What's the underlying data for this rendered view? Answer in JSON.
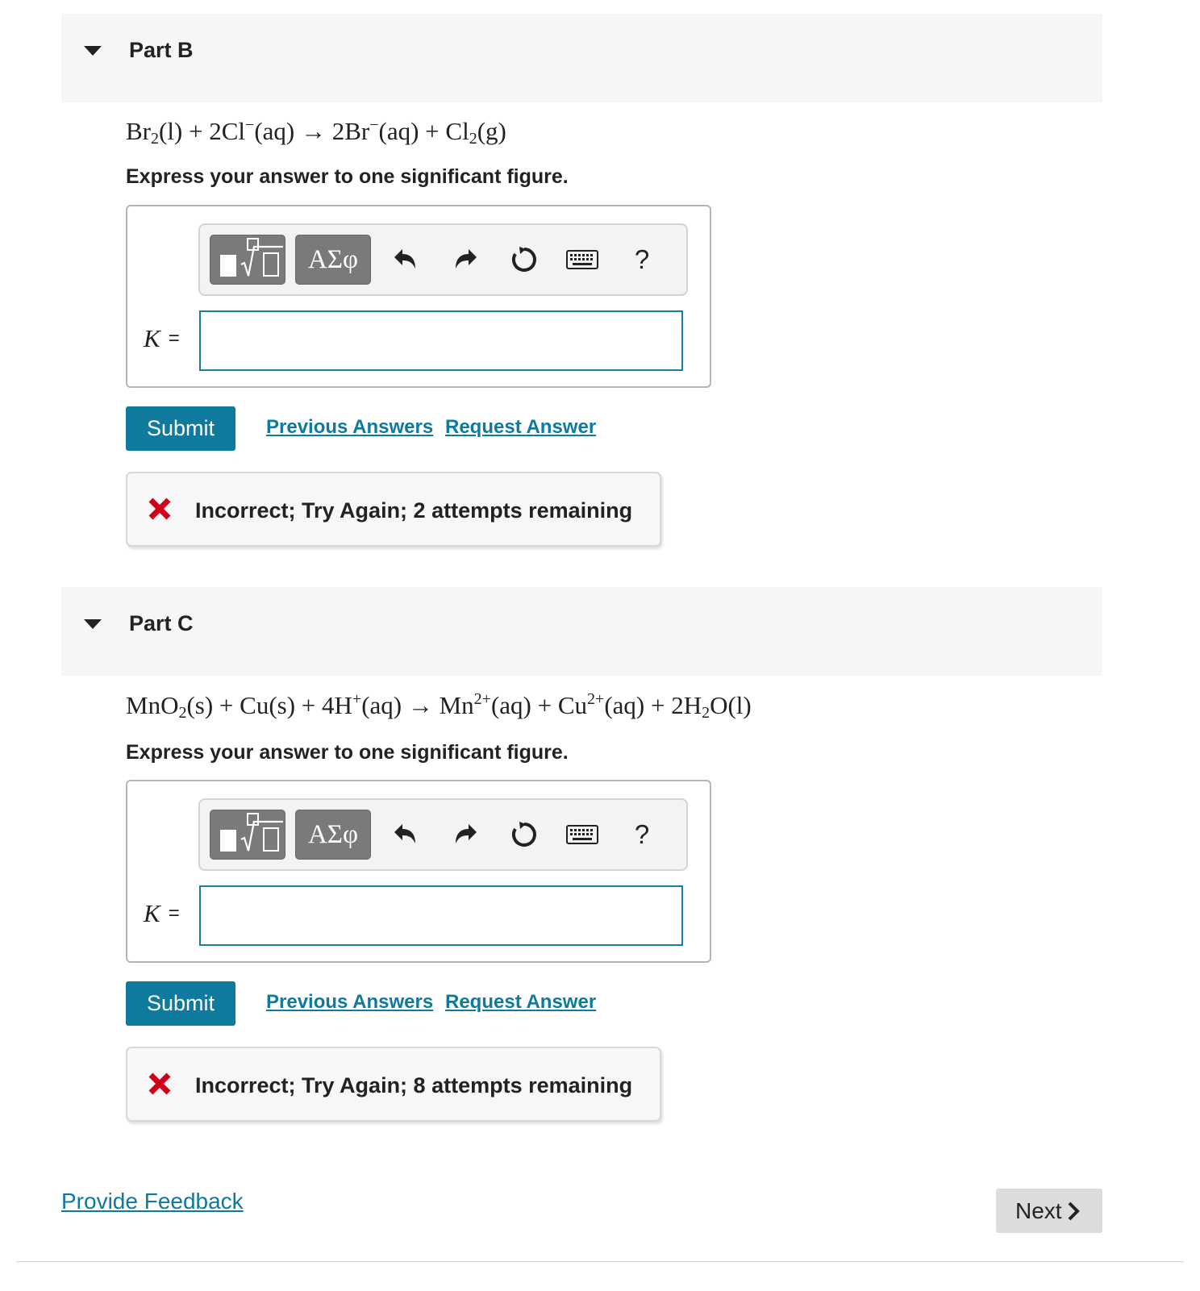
{
  "parts": [
    {
      "title": "Part B",
      "equation_html": "Br<sub>2</sub>(l) + 2Cl<sup>−</sup>(aq) → 2Br<sup>−</sup>(aq) + Cl<sub>2</sub>(g)",
      "instruction": "Express your answer to one significant figure.",
      "toolbar": {
        "greek_label": "ΑΣφ",
        "help_label": "?"
      },
      "answer_label": "K",
      "answer_eq": "=",
      "answer_value": "",
      "submit_label": "Submit",
      "previous_answers_label": "Previous Answers",
      "request_answer_label": "Request Answer",
      "feedback_text": "Incorrect; Try Again; 2 attempts remaining"
    },
    {
      "title": "Part C",
      "equation_html": "MnO<sub>2</sub>(s) + Cu(s) + 4H<sup>+</sup>(aq) → Mn<sup>2+</sup>(aq) + Cu<sup>2+</sup>(aq) + 2H<sub>2</sub>O(l)",
      "instruction": "Express your answer to one significant figure.",
      "toolbar": {
        "greek_label": "ΑΣφ",
        "help_label": "?"
      },
      "answer_label": "K",
      "answer_eq": "=",
      "answer_value": "",
      "submit_label": "Submit",
      "previous_answers_label": "Previous Answers",
      "request_answer_label": "Request Answer",
      "feedback_text": "Incorrect; Try Again; 8 attempts remaining"
    }
  ],
  "footer": {
    "provide_feedback_label": "Provide Feedback",
    "next_label": "Next"
  },
  "colors": {
    "accent": "#0e7a9e",
    "error": "#d0021b",
    "header_bg": "#f6f6f6"
  }
}
